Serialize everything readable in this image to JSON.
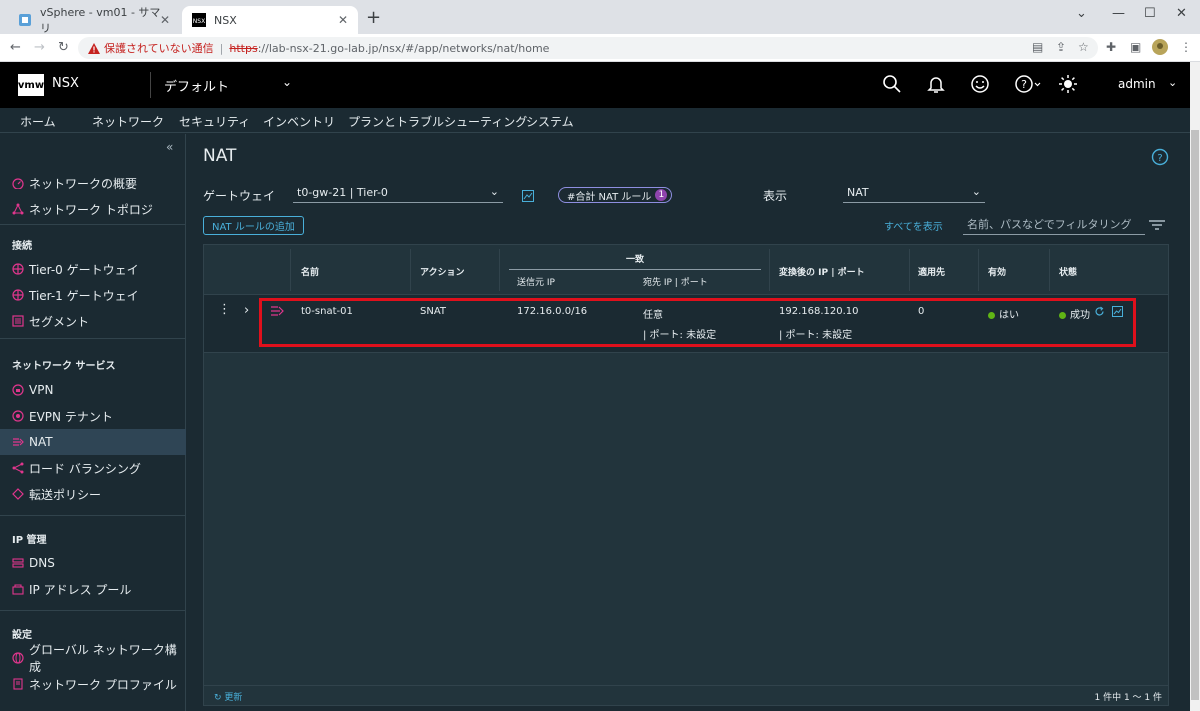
{
  "browser": {
    "tabs": [
      {
        "title": "vSphere - vm01 - サマリ"
      },
      {
        "title": "NSX"
      }
    ],
    "new_tab": "+",
    "security_warning": "保護されていない通信",
    "url_scheme": "https",
    "url_rest": "://lab-nsx-21.go-lab.jp/nsx/#/app/networks/nat/home"
  },
  "header": {
    "logo": "vmw",
    "app_name": "NSX",
    "context": "デフォルト",
    "user": "admin"
  },
  "main_nav": [
    "ホーム",
    "ネットワーク",
    "セキュリティ",
    "インベントリ",
    "プランとトラブルシューティング",
    "システム"
  ],
  "sidebar": {
    "top_items": [
      {
        "label": "ネットワークの概要",
        "icon": "dashboard-icon"
      },
      {
        "label": "ネットワーク トポロジ",
        "icon": "topology-icon"
      }
    ],
    "sections": [
      {
        "title": "接続",
        "items": [
          {
            "label": "Tier-0 ゲートウェイ",
            "icon": "tier0-gateway-icon"
          },
          {
            "label": "Tier-1 ゲートウェイ",
            "icon": "tier1-gateway-icon"
          },
          {
            "label": "セグメント",
            "icon": "segment-icon"
          }
        ]
      },
      {
        "title": "ネットワーク サービス",
        "items": [
          {
            "label": "VPN",
            "icon": "vpn-icon"
          },
          {
            "label": "EVPN テナント",
            "icon": "evpn-icon"
          },
          {
            "label": "NAT",
            "icon": "nat-icon"
          },
          {
            "label": "ロード バランシング",
            "icon": "load-balancing-icon"
          },
          {
            "label": "転送ポリシー",
            "icon": "forwarding-policy-icon"
          }
        ]
      },
      {
        "title": "IP 管理",
        "items": [
          {
            "label": "DNS",
            "icon": "dns-icon"
          },
          {
            "label": "IP アドレス プール",
            "icon": "ip-pool-icon"
          }
        ]
      },
      {
        "title": "設定",
        "items": [
          {
            "label": "グローバル ネットワーク構成",
            "icon": "global-config-icon"
          },
          {
            "label": "ネットワーク プロファイル",
            "icon": "network-profile-icon"
          }
        ]
      }
    ]
  },
  "content": {
    "title": "NAT",
    "gateway_label": "ゲートウェイ",
    "gateway_value": "t0-gw-21 | Tier-0",
    "nat_count_label": "#合計 NAT ルール",
    "nat_count": "1",
    "view_label": "表示",
    "view_value": "NAT",
    "add_button": "NAT ルールの追加",
    "show_all": "すべてを表示",
    "filter_placeholder": "名前、パスなどでフィルタリング",
    "table": {
      "headers": {
        "name": "名前",
        "action": "アクション",
        "match": "一致",
        "source_ip": "送信元 IP",
        "dest": "宛先 IP | ポート",
        "translated": "変換後の IP | ポート",
        "apply_to": "適用先",
        "enabled": "有効",
        "status": "状態"
      },
      "rows": [
        {
          "name": "t0-snat-01",
          "action": "SNAT",
          "source_ip": "172.16.0.0/16",
          "dest_ip": "任意",
          "dest_port": "| ポート: 未設定",
          "translated_ip": "192.168.120.10",
          "translated_port": "| ポート: 未設定",
          "apply_to": "0",
          "enabled": "はい",
          "status": "成功"
        }
      ],
      "refresh": "更新",
      "pager": "1 件中 1 ～ 1 件"
    }
  },
  "colors": {
    "accent": "#49afd9",
    "highlight_box": "#e0101c",
    "success": "#60b515",
    "nav_icon": "#e0368d"
  }
}
